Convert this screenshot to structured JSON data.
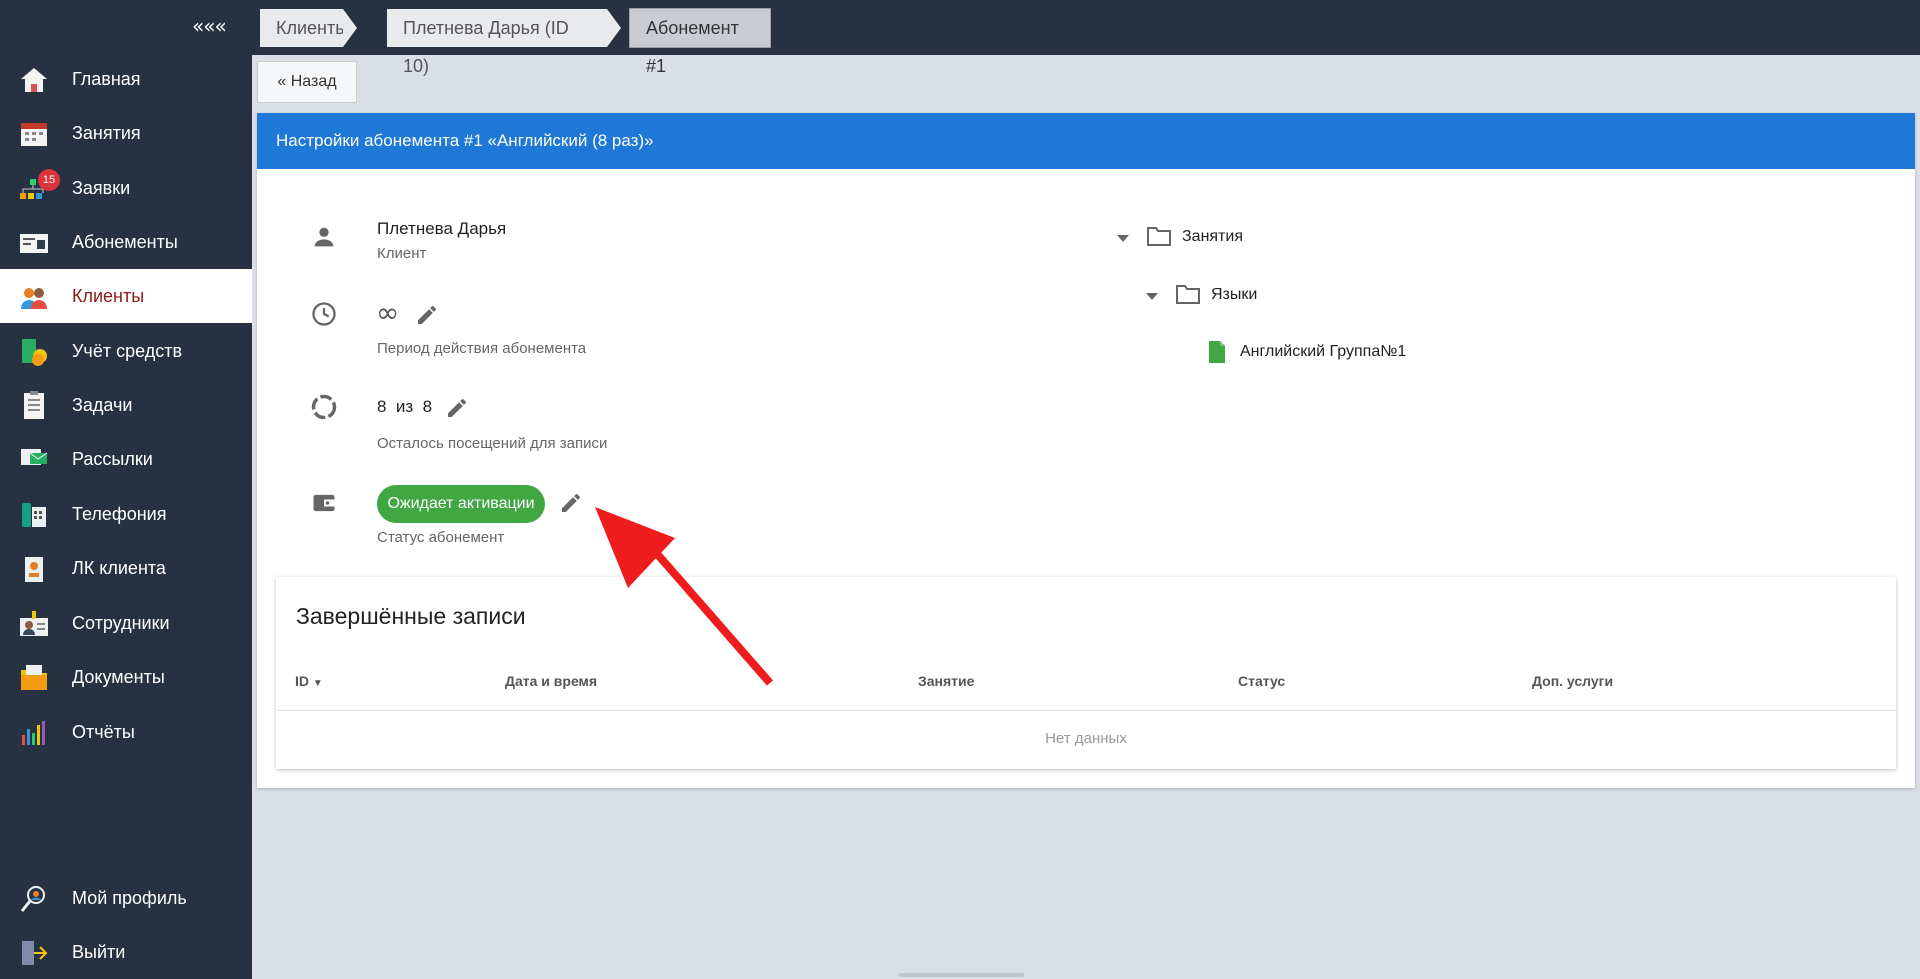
{
  "sidebar": {
    "collapse_label": "«««",
    "items": [
      {
        "label": "Главная",
        "icon": "home-icon"
      },
      {
        "label": "Занятия",
        "icon": "calendar-icon"
      },
      {
        "label": "Заявки",
        "icon": "requests-icon",
        "badge": "15"
      },
      {
        "label": "Абонементы",
        "icon": "card-icon"
      },
      {
        "label": "Клиенты",
        "icon": "clients-icon",
        "active": true
      },
      {
        "label": "Учёт средств",
        "icon": "money-icon"
      },
      {
        "label": "Задачи",
        "icon": "tasks-icon"
      },
      {
        "label": "Рассылки",
        "icon": "mailing-icon"
      },
      {
        "label": "Телефония",
        "icon": "phone-icon"
      },
      {
        "label": "ЛК клиента",
        "icon": "client-cabinet-icon"
      },
      {
        "label": "Сотрудники",
        "icon": "staff-icon"
      },
      {
        "label": "Документы",
        "icon": "documents-icon"
      },
      {
        "label": "Отчёты",
        "icon": "reports-icon"
      }
    ],
    "bottom": [
      {
        "label": "Мой профиль",
        "icon": "profile-icon"
      },
      {
        "label": "Выйти",
        "icon": "logout-icon"
      }
    ]
  },
  "breadcrumbs": [
    "Клиенты",
    "Плетнева Дарья (ID 10)",
    "Абонемент #1"
  ],
  "back_button": "« Назад",
  "card": {
    "header_prefix": "Настройки абонемента #1",
    "header_name": "«Английский (8 раз)»",
    "client_name": "Плетнева Дарья",
    "client_caption": "Клиент",
    "period_value": "∞",
    "period_caption": "Период действия абонемента",
    "visits_value": "8  из  8",
    "visits_caption": "Осталось посещений для записи",
    "status_value": "Ожидает активации",
    "status_caption": "Статус абонемент",
    "status_color": "#41a743",
    "header_color": "#1e78d6"
  },
  "tree": {
    "root": "Занятия",
    "child": "Языки",
    "leaf": "Английский Группа№1"
  },
  "records": {
    "title": "Завершённые записи",
    "columns": [
      "ID",
      "Дата и время",
      "Занятие",
      "Статус",
      "Доп. услуги"
    ],
    "empty": "Нет данных"
  }
}
